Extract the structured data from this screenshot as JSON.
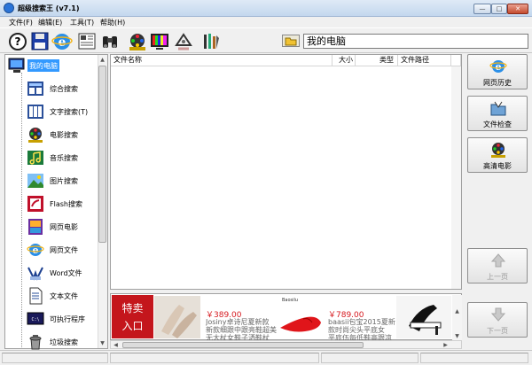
{
  "window": {
    "title": "超级搜索王 (v7.1)",
    "controls": [
      "—",
      "□",
      "✕"
    ]
  },
  "menu": [
    "文件(F)",
    "编辑(E)",
    "工具(T)",
    "帮助(H)"
  ],
  "toolbar": {
    "tools": [
      "help-icon",
      "save-icon",
      "ie-icon",
      "newspaper-icon",
      "binoculars-icon",
      "film-reel-icon",
      "tv-icon",
      "recycle-icon",
      "tools-icon"
    ],
    "path": "我的电脑"
  },
  "tree": {
    "root": "我的电脑",
    "items": [
      {
        "label": "综合搜索",
        "icon": "combined-search-icon"
      },
      {
        "label": "文字搜索(T)",
        "icon": "text-search-icon"
      },
      {
        "label": "电影搜索",
        "icon": "movie-reel-icon"
      },
      {
        "label": "音乐搜索",
        "icon": "music-icon"
      },
      {
        "label": "图片搜索",
        "icon": "picture-icon"
      },
      {
        "label": "Flash搜索",
        "icon": "flash-icon"
      },
      {
        "label": "网页电影",
        "icon": "web-movie-icon"
      },
      {
        "label": "网页文件",
        "icon": "ie-icon"
      },
      {
        "label": "Word文件",
        "icon": "word-icon"
      },
      {
        "label": "文本文件",
        "icon": "text-file-icon"
      },
      {
        "label": "可执行程序",
        "icon": "exe-icon"
      },
      {
        "label": "垃圾搜索",
        "icon": "trash-icon"
      }
    ]
  },
  "list": {
    "columns": [
      "文件名称",
      "大小",
      "类型",
      "文件路径"
    ]
  },
  "ad": {
    "left_line1": "特卖",
    "left_line2": "入口",
    "brand": "Baosilu",
    "item1_price": "￥389.00",
    "item1_line1": "Josiny卓诗尼夏新款",
    "item1_line2": "新款细跟中跟亮鞋超美",
    "item1_line3": "无大杖女鞋子洒鞋杖",
    "item2_price": "￥789.00",
    "item2_line1": "baasii包宝2015夏新",
    "item2_line2": "款时尚尖头平底女",
    "item2_line3": "平底伍每低鞋高跟凉鞋"
  },
  "side": {
    "buttons": [
      {
        "label": "网页历史",
        "icon": "ie-icon",
        "enabled": true
      },
      {
        "label": "文件检查",
        "icon": "folder-check-icon",
        "enabled": true
      },
      {
        "label": "高清电影",
        "icon": "film-reel-icon",
        "enabled": true
      },
      {
        "label": "上一页",
        "icon": "up-arrow-icon",
        "enabled": false
      },
      {
        "label": "下一页",
        "icon": "down-arrow-icon",
        "enabled": false
      }
    ]
  },
  "colors": {
    "selection": "#3399ff",
    "ad_red": "#c4161c",
    "price_red": "#d6181e"
  }
}
